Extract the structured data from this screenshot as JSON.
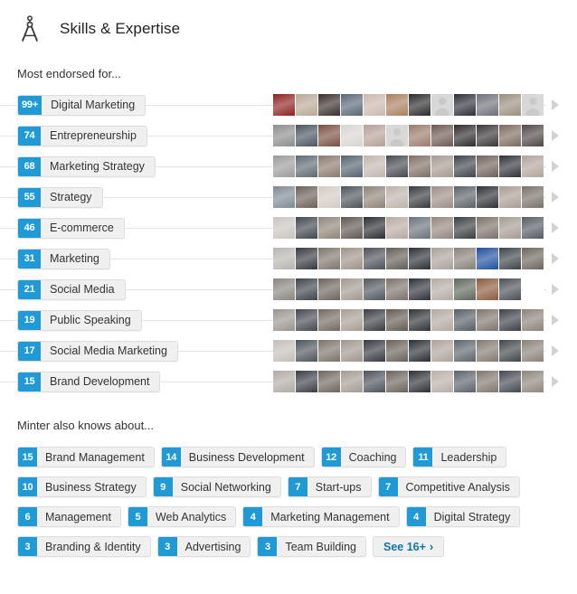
{
  "header": {
    "title": "Skills & Expertise",
    "icon": "compass-icon"
  },
  "most_endorsed": {
    "heading": "Most endorsed for...",
    "skills": [
      {
        "count": "99+",
        "name": "Digital Marketing"
      },
      {
        "count": "74",
        "name": "Entrepreneurship"
      },
      {
        "count": "68",
        "name": "Marketing Strategy"
      },
      {
        "count": "55",
        "name": "Strategy"
      },
      {
        "count": "46",
        "name": "E-commerce"
      },
      {
        "count": "31",
        "name": "Marketing"
      },
      {
        "count": "21",
        "name": "Social Media"
      },
      {
        "count": "19",
        "name": "Public Speaking"
      },
      {
        "count": "17",
        "name": "Social Media Marketing"
      },
      {
        "count": "15",
        "name": "Brand Development"
      }
    ],
    "endorsers_per_row": 12,
    "row_arrow_icon": "chevron-right-icon"
  },
  "also_knows": {
    "heading": "Minter also knows about...",
    "rows": [
      [
        {
          "count": "15",
          "name": "Brand Management"
        },
        {
          "count": "14",
          "name": "Business Development"
        },
        {
          "count": "12",
          "name": "Coaching"
        },
        {
          "count": "11",
          "name": "Leadership"
        }
      ],
      [
        {
          "count": "10",
          "name": "Business Strategy"
        },
        {
          "count": "9",
          "name": "Social Networking"
        },
        {
          "count": "7",
          "name": "Start-ups"
        },
        {
          "count": "7",
          "name": "Competitive Analysis"
        }
      ],
      [
        {
          "count": "6",
          "name": "Management"
        },
        {
          "count": "5",
          "name": "Web Analytics"
        },
        {
          "count": "4",
          "name": "Marketing Management"
        },
        {
          "count": "4",
          "name": "Digital Strategy"
        }
      ],
      [
        {
          "count": "3",
          "name": "Branding & Identity"
        },
        {
          "count": "3",
          "name": "Advertising"
        },
        {
          "count": "3",
          "name": "Team Building"
        }
      ]
    ],
    "see_more_label": "See 16+",
    "see_more_chevron": "›"
  },
  "colors": {
    "badge_blue": "#1f9ad6",
    "pill_background": "#f0f0f0",
    "pill_border": "#dddddd",
    "link_blue": "#0e76a8",
    "connector_line": "#e4e4e4",
    "arrow_gray": "#d2d2d2"
  },
  "endorser_rows": [
    [
      "#8d2220",
      "#b9a896",
      "#3a2f2c",
      "#5a6676",
      "#c9b8ad",
      "#a8805e",
      "#2b2b2b",
      "placeholder",
      "#2d3038",
      "#6e7078",
      "#9a8f7e",
      "placeholder"
    ],
    [
      "#8c8c8c",
      "#4a5560",
      "#7a4f42",
      "#d8d4d2",
      "#b4a097",
      "placeholder",
      "#9b7b6a",
      "#6d5a52",
      "#2f2b2c",
      "#3a3436",
      "#7d6a60",
      "#4e4744"
    ],
    [
      "#9b9b9b",
      "#5c6a72",
      "#8a7a6c",
      "#55626e",
      "#c2b6ae",
      "#45494e",
      "#7e6f64",
      "#a59a90",
      "#3d4349",
      "#6f6257",
      "#2e3338",
      "#b0a49b"
    ],
    [
      "#7d8a93",
      "#6b5f58",
      "#d2cac4",
      "#4d5359",
      "#8e8278",
      "#bcb2aa",
      "#37393d",
      "#9c8e84",
      "#5a6168",
      "#2c3034",
      "#a89c92",
      "#787068"
    ],
    [
      "#c9c4bf",
      "#40464c",
      "#8f8478",
      "#5e5550",
      "#2a2d31",
      "#b6aaa0",
      "#6a7178",
      "#92867c",
      "#383c40",
      "#7b7068",
      "#a49a91",
      "#545b62"
    ],
    [
      "#b8b4b0",
      "#353a3f",
      "#7f756c",
      "#9e9288",
      "#4b5158",
      "#635c56",
      "#2b2f33",
      "#aaa099",
      "#88807a",
      "#1f4f9e",
      "#3c4348",
      "#6d645c"
    ],
    [
      "#8a8680",
      "#3e444a",
      "#6c635b",
      "#a29890",
      "#50565c",
      "#7a716a",
      "#2d3136",
      "#b4aaa2",
      "#5f665c",
      "#8b5a3c",
      "#4a4f55",
      "#ffffff"
    ],
    [
      "#9a948e",
      "#44494f",
      "#726960",
      "#a69c94",
      "#383d42",
      "#635a52",
      "#2e3236",
      "#b2a89f",
      "#565d64",
      "#7e756c",
      "#3b4046",
      "#8c8279"
    ],
    [
      "#c4beb8",
      "#4e545a",
      "#7b7269",
      "#9f958c",
      "#353a40",
      "#686058",
      "#2a2e32",
      "#ada39a",
      "#5d646b",
      "#827970",
      "#404549",
      "#8a8178"
    ],
    [
      "#b0aaa4",
      "#3a3f45",
      "#6e655d",
      "#a49a92",
      "#4c525a",
      "#6b625a",
      "#2c3035",
      "#b8aea6",
      "#5b626a",
      "#7f766d",
      "#434850",
      "#8e857c"
    ]
  ]
}
